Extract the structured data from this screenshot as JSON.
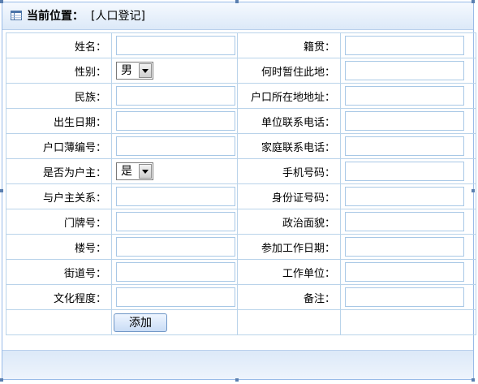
{
  "header": {
    "title": "当前位置：",
    "location": "[人口登记]"
  },
  "colors": {
    "border": "#b9d3ea",
    "header_bg": "#dce9f8"
  },
  "icons": {
    "header": "table-icon"
  },
  "rows": [
    {
      "left_label": "姓名：",
      "left_value": "",
      "right_label": "籍贯：",
      "right_value": ""
    },
    {
      "left_label": "性别：",
      "left_select": "男",
      "right_label": "何时暂住此地：",
      "right_value": ""
    },
    {
      "left_label": "民族：",
      "left_value": "",
      "right_label": "户口所在地地址：",
      "right_value": ""
    },
    {
      "left_label": "出生日期：",
      "left_value": "",
      "right_label": "单位联系电话：",
      "right_value": ""
    },
    {
      "left_label": "户口薄编号：",
      "left_value": "",
      "right_label": "家庭联系电话：",
      "right_value": ""
    },
    {
      "left_label": "是否为户主：",
      "left_select": "是",
      "right_label": "手机号码：",
      "right_value": ""
    },
    {
      "left_label": "与户主关系：",
      "left_value": "",
      "right_label": "身份证号码：",
      "right_value": ""
    },
    {
      "left_label": "门牌号：",
      "left_value": "",
      "right_label": "政治面貌：",
      "right_value": ""
    },
    {
      "left_label": "楼号：",
      "left_value": "",
      "right_label": "参加工作日期：",
      "right_value": ""
    },
    {
      "left_label": "街道号：",
      "left_value": "",
      "right_label": "工作单位：",
      "right_value": ""
    },
    {
      "left_label": "文化程度：",
      "left_value": "",
      "right_label": "备注：",
      "right_value": ""
    }
  ],
  "actions": {
    "add_label": "添加"
  }
}
